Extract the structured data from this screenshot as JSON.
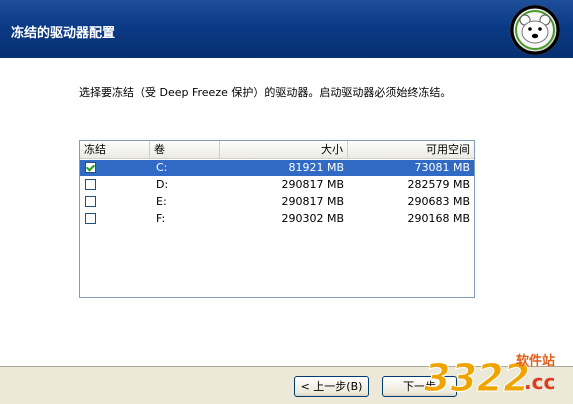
{
  "header": {
    "title": "冻结的驱动器配置",
    "logo": "deep-freeze-polar-bear-logo"
  },
  "instruction": "选择要冻结（受 Deep Freeze 保护）的驱动器。启动驱动器必须始终冻结。",
  "table": {
    "columns": [
      "冻结",
      "卷",
      "大小",
      "可用空间"
    ],
    "rows": [
      {
        "frozen": true,
        "volume": "C:",
        "size": "81921 MB",
        "free": "73081 MB",
        "selected": true
      },
      {
        "frozen": false,
        "volume": "D:",
        "size": "290817 MB",
        "free": "282579 MB",
        "selected": false
      },
      {
        "frozen": false,
        "volume": "E:",
        "size": "290817 MB",
        "free": "290683 MB",
        "selected": false
      },
      {
        "frozen": false,
        "volume": "F:",
        "size": "290302 MB",
        "free": "290168 MB",
        "selected": false
      }
    ]
  },
  "buttons": {
    "back": "< 上一步(B)",
    "next": "下一步"
  },
  "watermark": {
    "number": "3322",
    "text": "软件站",
    "suffix": ".cc"
  },
  "colors": {
    "header_bg": "#0b3a86",
    "selection": "#316ac5",
    "footer_bg": "#ece9d8"
  }
}
